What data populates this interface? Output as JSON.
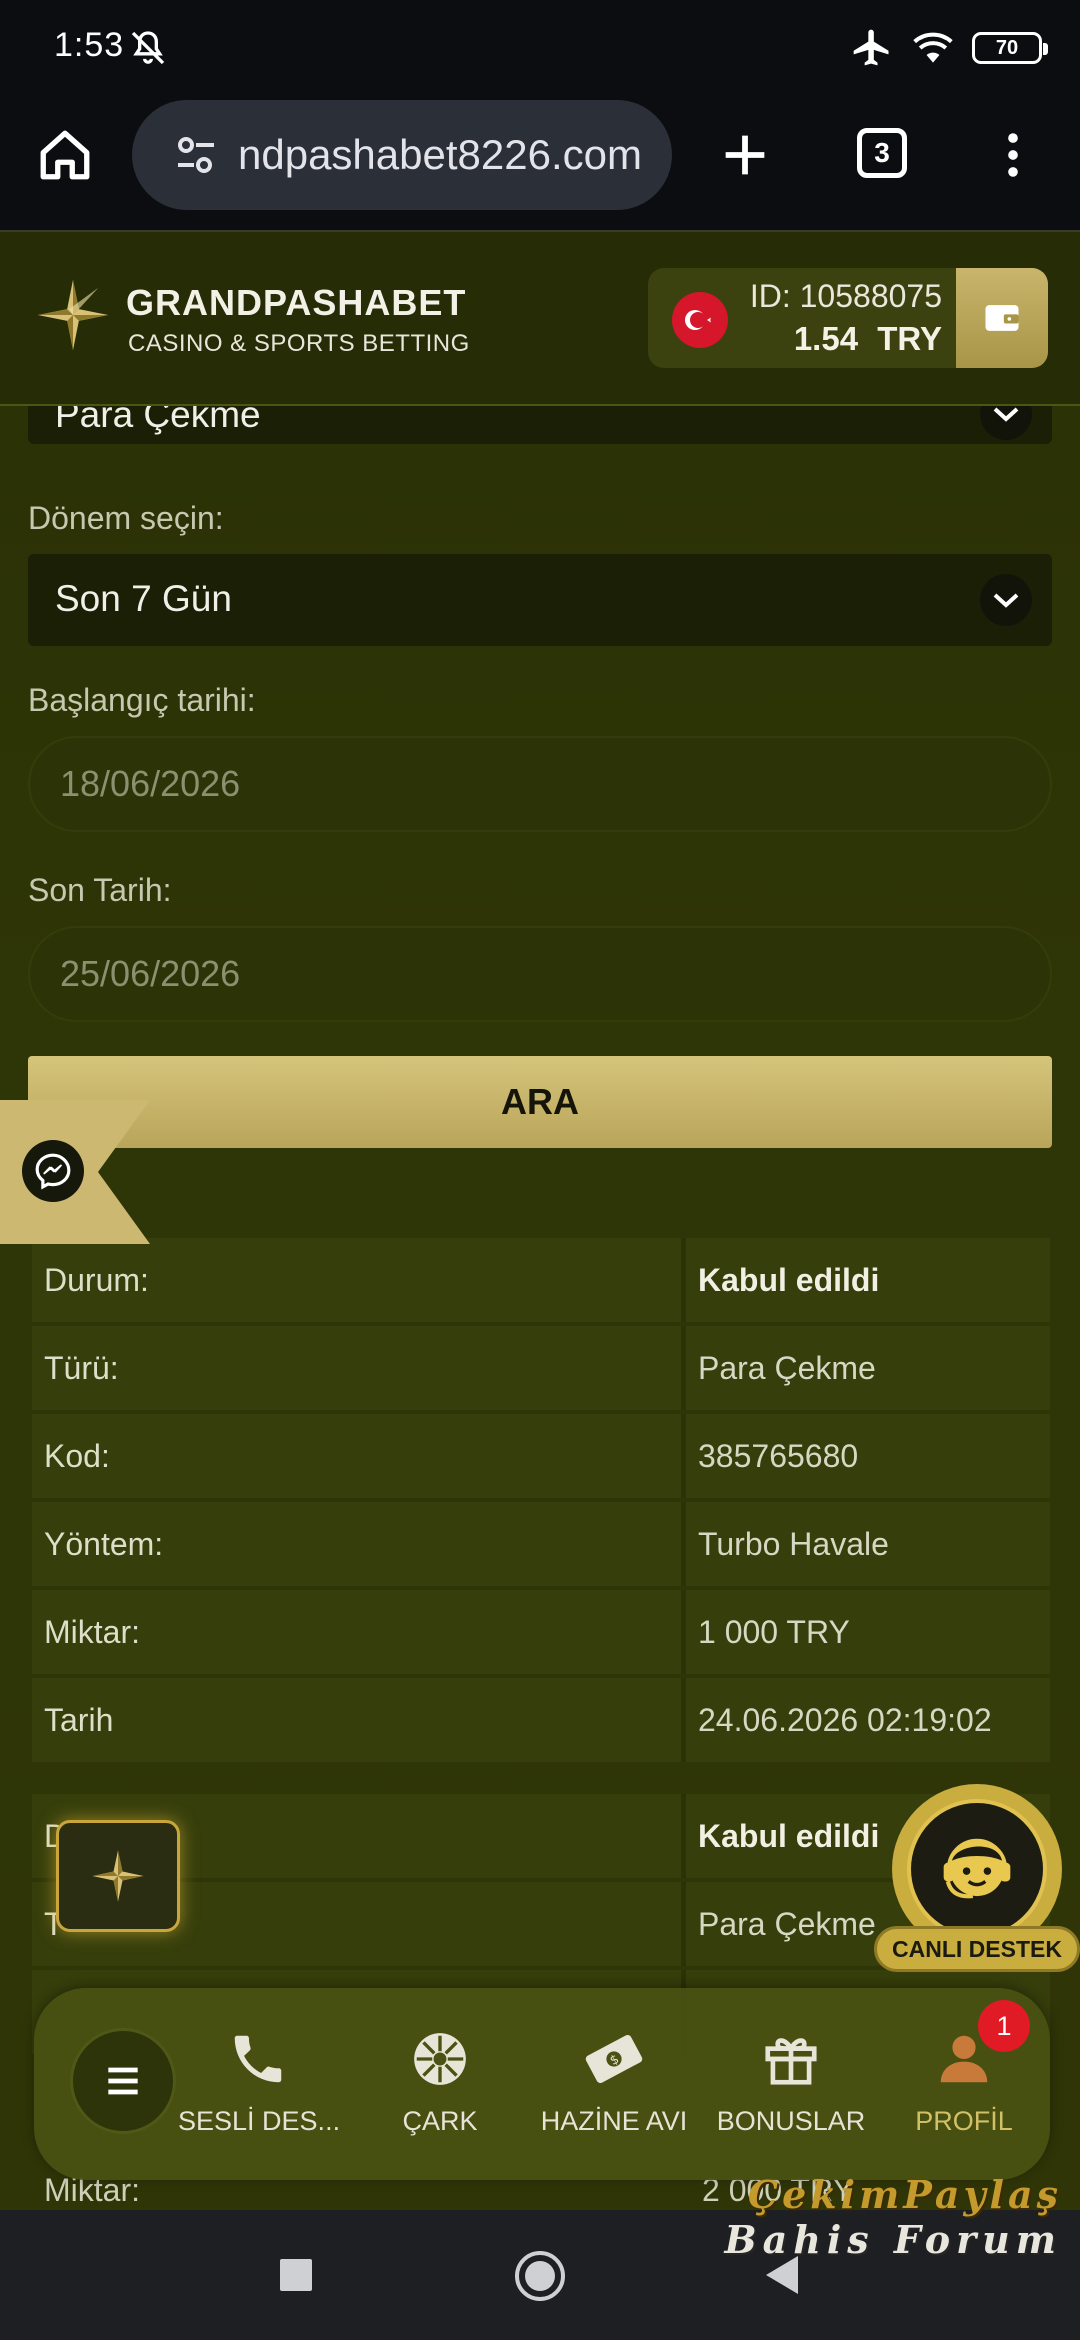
{
  "status_bar": {
    "time": "1:53",
    "battery": "70"
  },
  "browser": {
    "url": "ndpashabet8226.com",
    "tab_count": "3"
  },
  "header": {
    "brand": "GRANDPASHABET",
    "tagline": "CASINO & SPORTS BETTING",
    "account_id": "ID: 10588075",
    "balance": "1.54 TRY"
  },
  "form": {
    "type_value": "Para Çekme",
    "period_label": "Dönem seçin:",
    "period_value": "Son 7 Gün",
    "start_label": "Başlangıç tarihi:",
    "start_placeholder": "18/06/2026",
    "end_label": "Son Tarih:",
    "end_placeholder": "25/06/2026",
    "search_label": "ARA"
  },
  "transactions": [
    {
      "rows": [
        {
          "key": "Durum:",
          "value": "Kabul edildi"
        },
        {
          "key": "Türü:",
          "value": "Para Çekme"
        },
        {
          "key": "Kod:",
          "value": "385765680"
        },
        {
          "key": "Yöntem:",
          "value": "Turbo Havale"
        },
        {
          "key": "Miktar:",
          "value": "1 000 TRY"
        },
        {
          "key": "Tarih",
          "value": "24.06.2026 02:19:02"
        }
      ]
    },
    {
      "rows": [
        {
          "key": "D",
          "value": "Kabul edildi"
        },
        {
          "key": "T",
          "value": "Para Çekme"
        }
      ],
      "peek": {
        "key": "Miktar:",
        "value": "2 000 TRY"
      }
    }
  ],
  "support": {
    "label": "CANLI DESTEK"
  },
  "bottom_nav": {
    "items": [
      {
        "label": "SESLİ DES...",
        "icon": "phone-icon"
      },
      {
        "label": "ÇARK",
        "icon": "wheel-icon"
      },
      {
        "label": "HAZİNE AVI",
        "icon": "treasure-icon"
      },
      {
        "label": "BONUSLAR",
        "icon": "gift-icon"
      },
      {
        "label": "PROFİL",
        "icon": "user-icon"
      }
    ],
    "profile_badge": "1"
  },
  "watermark": {
    "line1": "ÇekimPaylaş",
    "line2": "Bahis Forum"
  },
  "colors": {
    "accent_gold": "#c9b56b",
    "page_bg": "#2e3506",
    "notification": "#e01b25"
  }
}
